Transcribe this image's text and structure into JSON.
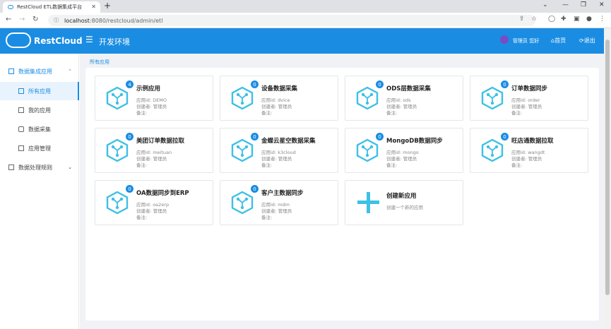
{
  "browser": {
    "tab_title": "RestCloud ETL数据集成平台",
    "url_host": "localhost",
    "url_path": ":8080/restcloud/admin/etl"
  },
  "header": {
    "logo_text": "RestCloud",
    "env_title": "开发环境",
    "user_greeting": "管理员 您好",
    "home_label": "首页",
    "logout_label": "退出"
  },
  "sidebar": {
    "items": [
      {
        "label": "数据集成应用",
        "icon": "grid-icon",
        "type": "group"
      },
      {
        "label": "所有应用",
        "icon": "grid-icon",
        "type": "active"
      },
      {
        "label": "我的应用",
        "icon": "doc-icon",
        "type": "sub"
      },
      {
        "label": "数据采集",
        "icon": "tag-icon",
        "type": "sub"
      },
      {
        "label": "应用管理",
        "icon": "grid-icon",
        "type": "sub"
      },
      {
        "label": "数据处理规则",
        "icon": "doc-icon",
        "type": "group2"
      }
    ]
  },
  "breadcrumb": "所有应用",
  "apps": [
    {
      "name": "示例应用",
      "id": "应用id: DEMO",
      "creator": "创建者: 管理员",
      "note": "备注:",
      "count": "4"
    },
    {
      "name": "设备数据采集",
      "id": "应用id: dvice",
      "creator": "创建者: 管理员",
      "note": "备注:",
      "count": "0"
    },
    {
      "name": "ODS层数据采集",
      "id": "应用id: ods",
      "creator": "创建者: 管理员",
      "note": "备注:",
      "count": "0"
    },
    {
      "name": "订单数据同步",
      "id": "应用id: order",
      "creator": "创建者: 管理员",
      "note": "备注:",
      "count": "0"
    },
    {
      "name": "美团订单数据拉取",
      "id": "应用id: meituan",
      "creator": "创建者: 管理员",
      "note": "备注:",
      "count": "0"
    },
    {
      "name": "金蝶云星空数据采集",
      "id": "应用id: k3cloud",
      "creator": "创建者: 管理员",
      "note": "备注:",
      "count": "0"
    },
    {
      "name": "MongoDB数据同步",
      "id": "应用id: mongo",
      "creator": "创建者: 管理员",
      "note": "备注:",
      "count": "0"
    },
    {
      "name": "旺店通数据拉取",
      "id": "应用id: wangdt",
      "creator": "创建者: 管理员",
      "note": "备注:",
      "count": "0"
    },
    {
      "name": "OA数据同步到ERP",
      "id": "应用id: oa2erp",
      "creator": "创建者: 管理员",
      "note": "备注:",
      "count": "0"
    },
    {
      "name": "客户主数据同步",
      "id": "应用id: mdm",
      "creator": "创建者: 管理员",
      "note": "备注:",
      "count": "0"
    }
  ],
  "new_app": {
    "title": "创建新应用",
    "subtitle": "创建一个新的应用"
  },
  "colors": {
    "accent": "#1a8de3",
    "icon": "#3ec0e6"
  }
}
